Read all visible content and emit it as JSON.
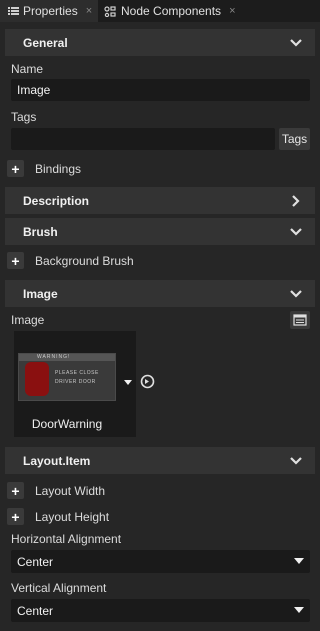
{
  "tabs": [
    {
      "label": "Properties",
      "icon": "list-icon",
      "close": "×"
    },
    {
      "label": "Node Components",
      "icon": "components-icon",
      "close": "×"
    }
  ],
  "sections": {
    "general": "General",
    "description": "Description",
    "brush": "Brush",
    "image": "Image",
    "layout_item": "Layout.Item"
  },
  "general": {
    "name_label": "Name",
    "name_value": "Image",
    "tags_label": "Tags",
    "tags_value": "",
    "tags_button": "Tags",
    "bindings_label": "Bindings"
  },
  "brush": {
    "background_brush_label": "Background Brush"
  },
  "image": {
    "label": "Image",
    "thumb_header": "WARNING!",
    "thumb_line1": "PLEASE CLOSE",
    "thumb_line2": "DRIVER DOOR",
    "resource_name": "DoorWarning"
  },
  "layout": {
    "width_label": "Layout Width",
    "height_label": "Layout Height",
    "halign_label": "Horizontal Alignment",
    "halign_value": "Center",
    "valign_label": "Vertical Alignment",
    "valign_value": "Center"
  },
  "colors": {
    "panel_bg": "#262626",
    "section_bg": "#333333",
    "field_bg": "#1a1a1a",
    "thumb_red": "#8a1010"
  }
}
